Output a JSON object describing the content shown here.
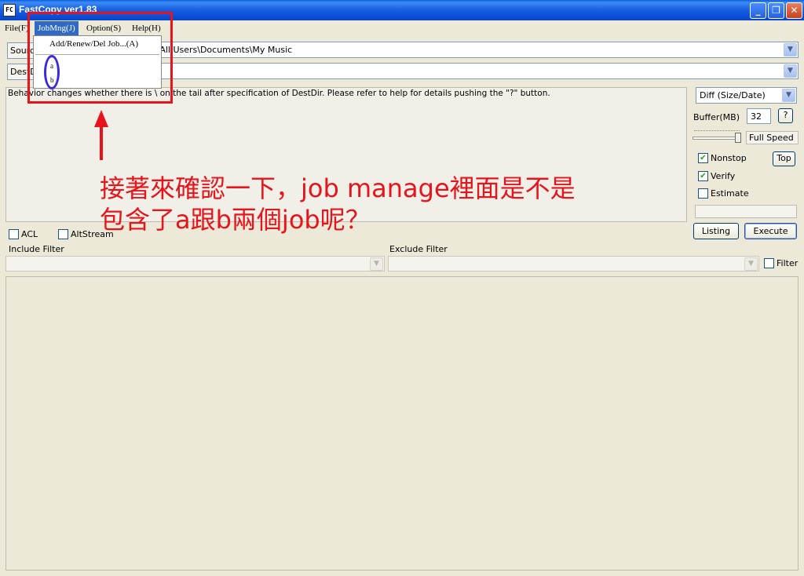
{
  "window": {
    "icon_text": "FC",
    "title": "FastCopy ver1.83",
    "minimize": "_",
    "maximize": "❐",
    "close": "✕"
  },
  "menu": {
    "file": "File(F)",
    "jobmng": "JobMng(J)",
    "option": "Option(S)",
    "help": "Help(H)"
  },
  "jobmng_dropdown": {
    "add_item": "Add/Renew/Del Job...(A)",
    "jobs": [
      "a",
      "b"
    ]
  },
  "source": {
    "button": "Source",
    "path": "C:\\Documents and Settings\\All Users\\Documents\\My Music"
  },
  "dest": {
    "button": "DestDir",
    "path": ""
  },
  "message": "Behavior changes whether there is \\ on the tail after specification of DestDir. Please refer to help for details pushing the \"?\" button.",
  "mode": {
    "selected": "Diff (Size/Date)"
  },
  "buffer": {
    "label": "Buffer(MB)",
    "value": "32",
    "help_button": "?"
  },
  "speed": {
    "label": "Full Speed",
    "level": 1.0
  },
  "options": {
    "nonstop": {
      "label": "Nonstop",
      "checked": true
    },
    "top_button": "Top",
    "verify": {
      "label": "Verify",
      "checked": true
    },
    "estimate": {
      "label": "Estimate",
      "checked": false
    }
  },
  "actions": {
    "listing": "Listing",
    "execute": "Execute"
  },
  "flags": {
    "acl": {
      "label": "ACL",
      "checked": false
    },
    "altstream": {
      "label": "AltStream",
      "checked": false
    }
  },
  "filters": {
    "include_label": "Include Filter",
    "exclude_label": "Exclude Filter",
    "filter_checkbox": {
      "label": "Filter",
      "checked": false
    }
  },
  "annotation": {
    "line1": "接著來確認一下，job manage裡面是不是",
    "line2": "包含了a跟b兩個job呢？"
  },
  "colors": {
    "annotation": "#e8141c",
    "circle": "#3a2adc",
    "titlebar": "#0a4ed6",
    "menu_highlight": "#316ac5"
  }
}
